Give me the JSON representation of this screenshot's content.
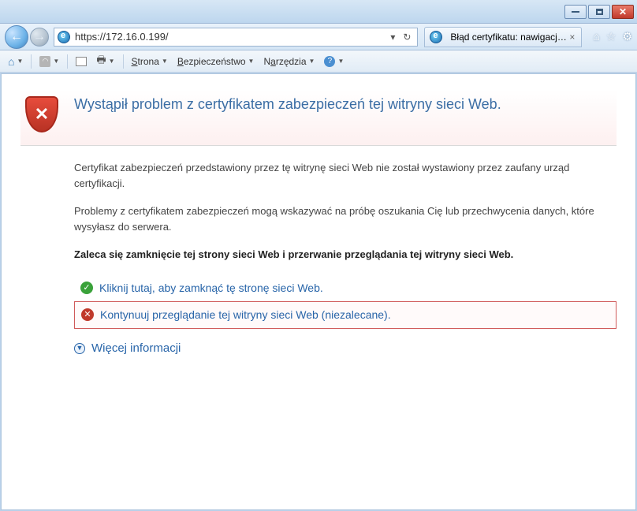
{
  "url": "https://172.16.0.199/",
  "tab": {
    "title": "Błąd certyfikatu: nawigacja ..."
  },
  "cmdbar": {
    "page": "Strona",
    "safety": "Bezpieczeństwo",
    "tools": "Narzędzia"
  },
  "cert": {
    "title": "Wystąpił problem z certyfikatem zabezpieczeń tej witryny sieci Web.",
    "para1": "Certyfikat zabezpieczeń przedstawiony przez tę witrynę sieci Web nie został wystawiony przez zaufany urząd certyfikacji.",
    "para2": "Problemy z certyfikatem zabezpieczeń mogą wskazywać na próbę oszukania Cię lub przechwycenia danych, które wysyłasz do serwera.",
    "recommend": "Zaleca się zamknięcie tej strony sieci Web i przerwanie przeglądania tej witryny sieci Web.",
    "close_link": "Kliknij tutaj, aby zamknąć tę stronę sieci Web.",
    "continue_link": "Kontynuuj przeglądanie tej witryny sieci Web (niezalecane).",
    "more_info": "Więcej informacji"
  }
}
